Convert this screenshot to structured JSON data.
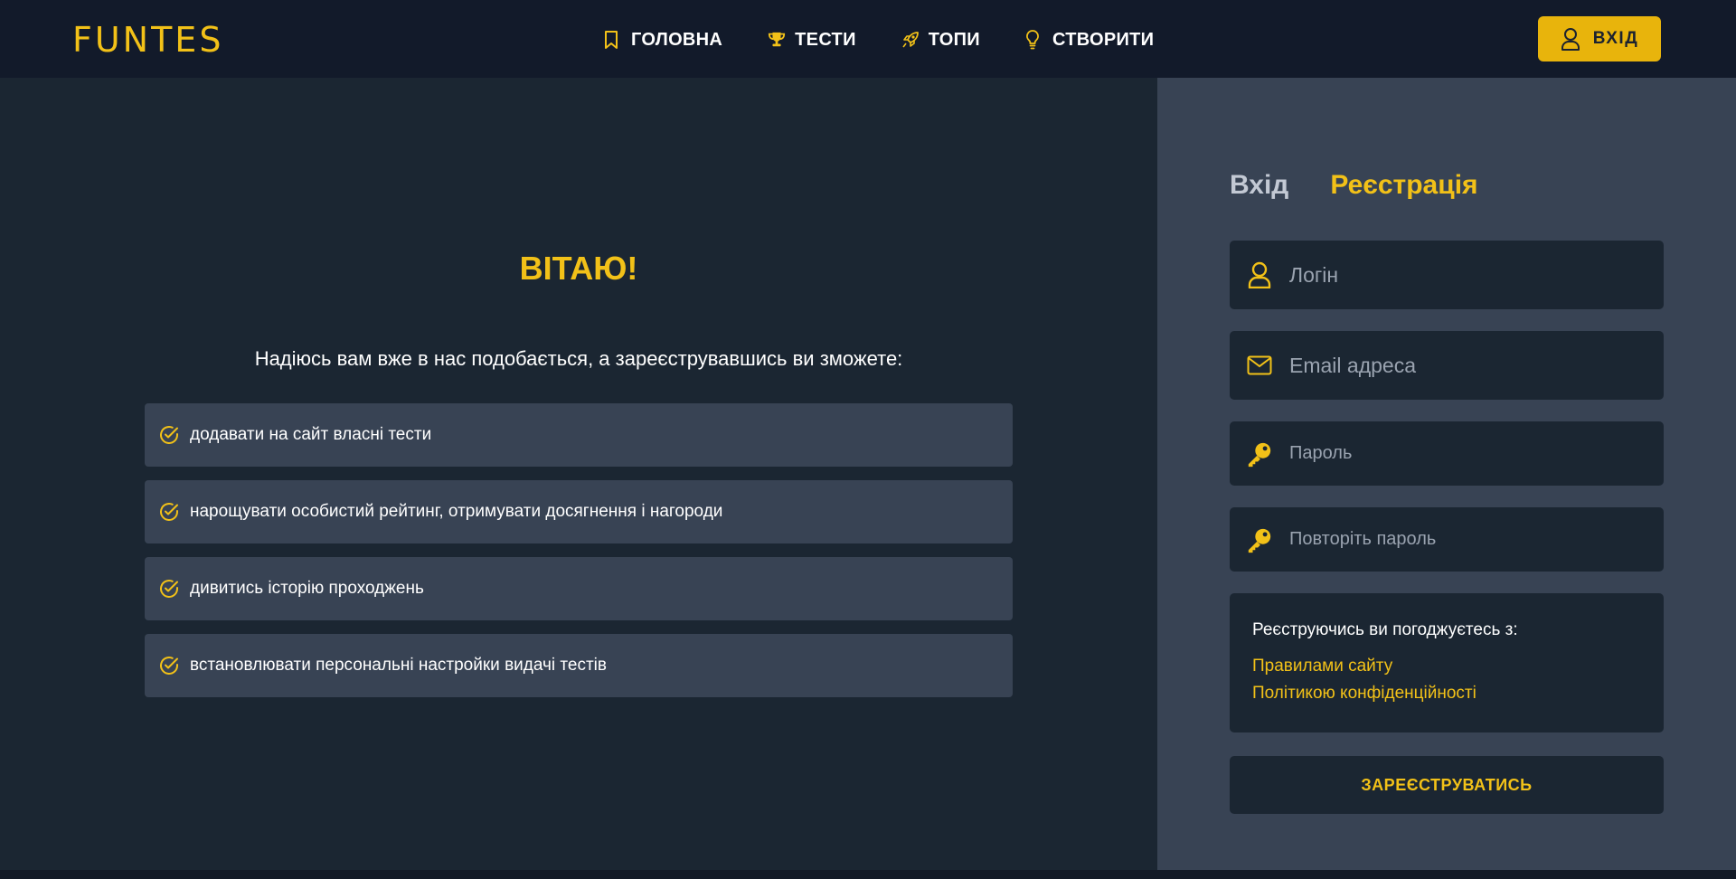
{
  "brand": {
    "logo": "FUNTES"
  },
  "nav": {
    "items": [
      {
        "label": "ГОЛОВНА",
        "icon": "bookmark-icon"
      },
      {
        "label": "ТЕСТИ",
        "icon": "trophy-icon"
      },
      {
        "label": "ТОПИ",
        "icon": "rocket-icon"
      },
      {
        "label": "СТВОРИТИ",
        "icon": "lightbulb-icon"
      }
    ],
    "login_label": "ВХІД",
    "login_icon": "user-icon"
  },
  "welcome": {
    "title": "ВІТАЮ!",
    "subtitle": "Надіюсь вам вже в нас подобається, а зареєструвавшись ви зможете:",
    "benefits": [
      "додавати на сайт власні тести",
      "нарощувати особистий рейтинг, отримувати досягнення і нагороди",
      "дивитись історію проходжень",
      "встановлювати персональні настройки видачі тестів"
    ]
  },
  "auth": {
    "tabs": [
      {
        "label": "Вхід",
        "active": false
      },
      {
        "label": "Реєстрація",
        "active": true
      }
    ],
    "fields": {
      "login": {
        "placeholder": "Логін",
        "value": "",
        "icon": "user-icon"
      },
      "email": {
        "placeholder": "Email адреса",
        "value": "",
        "icon": "envelope-icon"
      },
      "password": {
        "placeholder": "Пароль",
        "value": "",
        "icon": "key-icon"
      },
      "password_repeat": {
        "placeholder": "Повторіть пароль",
        "value": "",
        "icon": "key-icon"
      }
    },
    "terms": {
      "lead": "Реєструючись ви погоджуєтесь з:",
      "links": [
        "Правилами сайту",
        "Політикою конфіденційності"
      ]
    },
    "submit_label": "ЗАРЕЄСТРУВАТИСЬ"
  },
  "colors": {
    "accent": "#f2c118",
    "header_bg": "#121a2a",
    "left_bg": "#1b2632",
    "right_bg": "#384354",
    "button_bg": "#e8b40c"
  }
}
